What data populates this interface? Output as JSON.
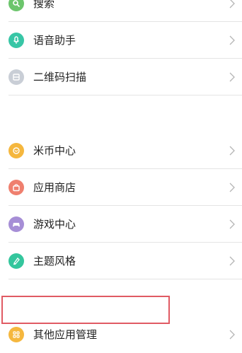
{
  "settings": {
    "group1": [
      {
        "label": "搜索",
        "icon": "search-icon",
        "color": "#6cc56c"
      },
      {
        "label": "语音助手",
        "icon": "microphone-icon",
        "color": "#38c6a6"
      },
      {
        "label": "二维码扫描",
        "icon": "qr-scan-icon",
        "color": "#c9ced6"
      }
    ],
    "group2": [
      {
        "label": "米币中心",
        "icon": "coin-icon",
        "color": "#f5b73e"
      },
      {
        "label": "应用商店",
        "icon": "shopping-bag-icon",
        "color": "#ef7f6e"
      },
      {
        "label": "游戏中心",
        "icon": "gamepad-icon",
        "color": "#a68ed6"
      },
      {
        "label": "主题风格",
        "icon": "brush-icon",
        "color": "#34c69d"
      }
    ],
    "group3": [
      {
        "label": "其他应用管理",
        "icon": "grid-icon",
        "color": "#f5b73e"
      }
    ],
    "highlight_color": "#e05a63"
  }
}
